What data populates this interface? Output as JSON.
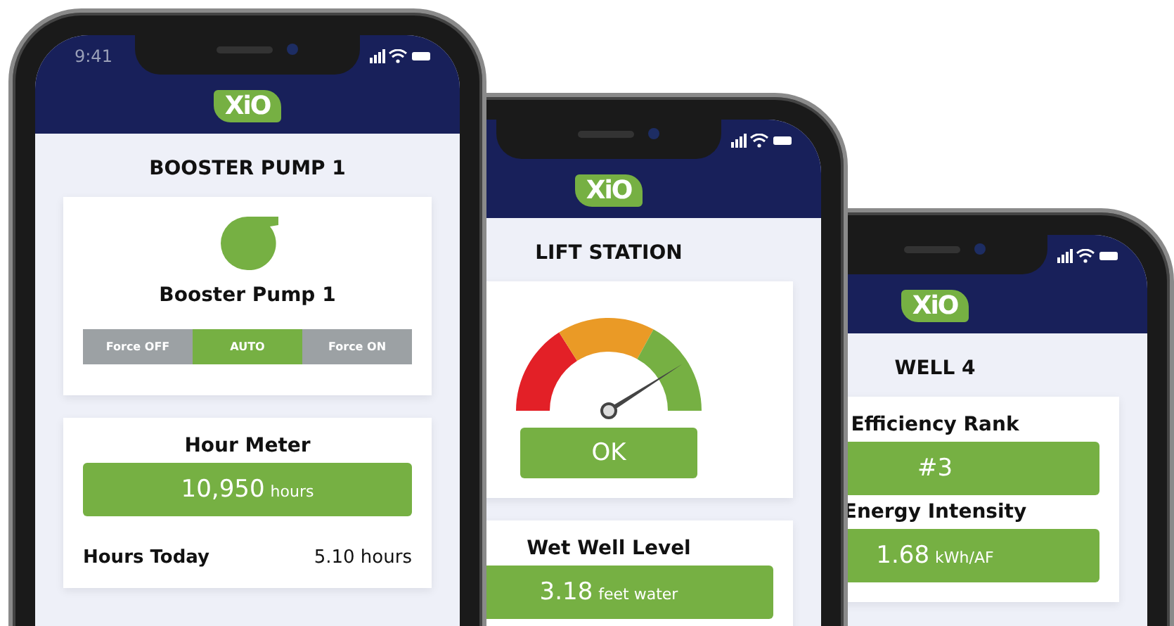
{
  "phones": [
    {
      "time": "9:41",
      "logo": "XiO",
      "title": "BOOSTER PUMP 1",
      "cards": [
        {
          "kind": "control",
          "name": "Booster Pump 1",
          "modes": [
            {
              "label": "Force OFF",
              "selected": false
            },
            {
              "label": "AUTO",
              "selected": true
            },
            {
              "label": "Force ON",
              "selected": false
            }
          ]
        },
        {
          "kind": "metrics",
          "items": [
            {
              "title": "Hour Meter",
              "value": "10,950",
              "unit": "hours"
            }
          ],
          "rows": [
            {
              "label": "Hours Today",
              "value": "5.10",
              "unit": "hours"
            }
          ]
        }
      ]
    },
    {
      "logo": "XiO",
      "title": "LIFT STATION",
      "cards": [
        {
          "kind": "gauge",
          "level": 0.82,
          "status": "OK"
        },
        {
          "kind": "metrics",
          "items": [
            {
              "title": "Wet Well Level",
              "value": "3.18",
              "unit": "feet water"
            }
          ]
        }
      ]
    },
    {
      "logo": "XiO",
      "title": "WELL 4",
      "cards": [
        {
          "kind": "metrics",
          "items": [
            {
              "title": "Efficiency Rank",
              "value": "#3"
            },
            {
              "title": "Energy Intensity",
              "value": "1.68",
              "unit": "kWh/AF"
            }
          ]
        }
      ]
    }
  ]
}
